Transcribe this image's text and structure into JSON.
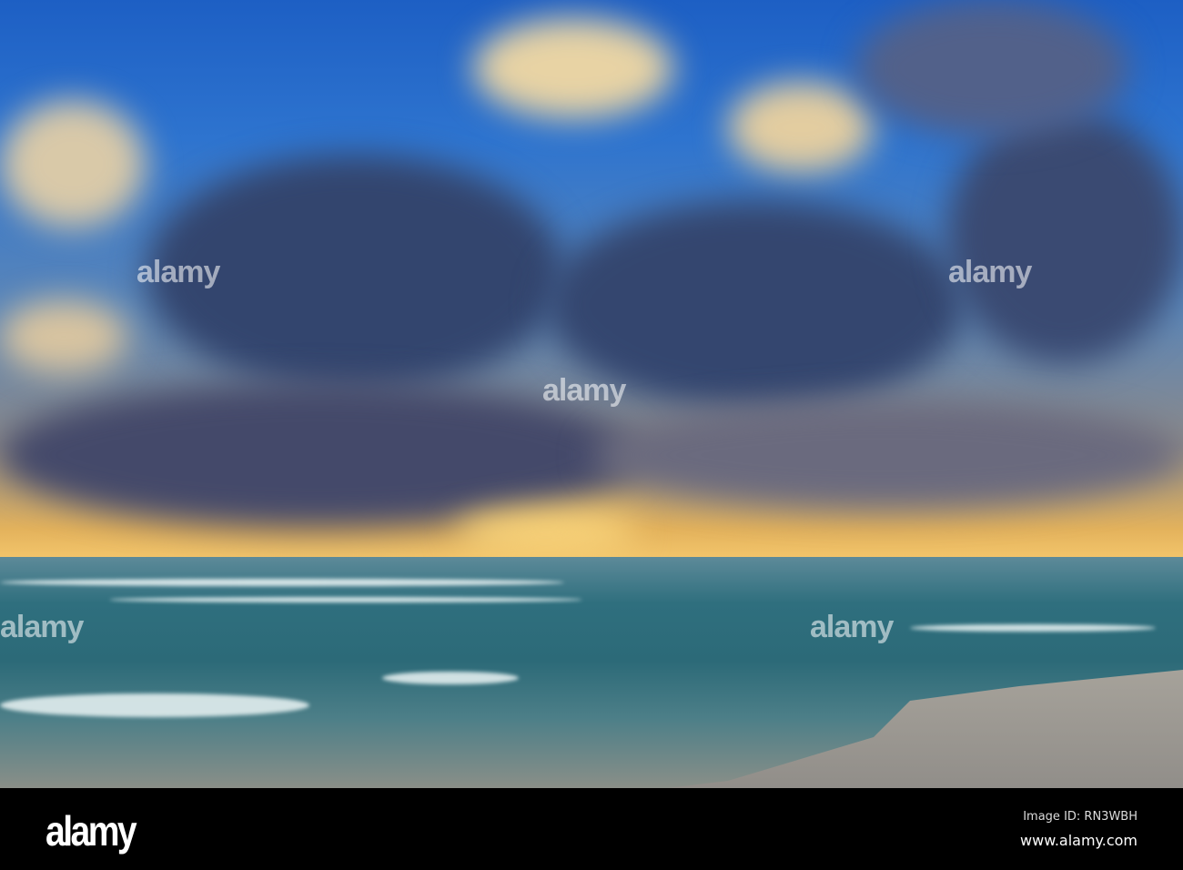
{
  "photo": {
    "subject": "sunset over ocean beach with clouds"
  },
  "watermark": {
    "text": "alamy"
  },
  "footer": {
    "logo": "alamy",
    "image_id": "Image ID: RN3WBH",
    "website": "www.alamy.com"
  }
}
